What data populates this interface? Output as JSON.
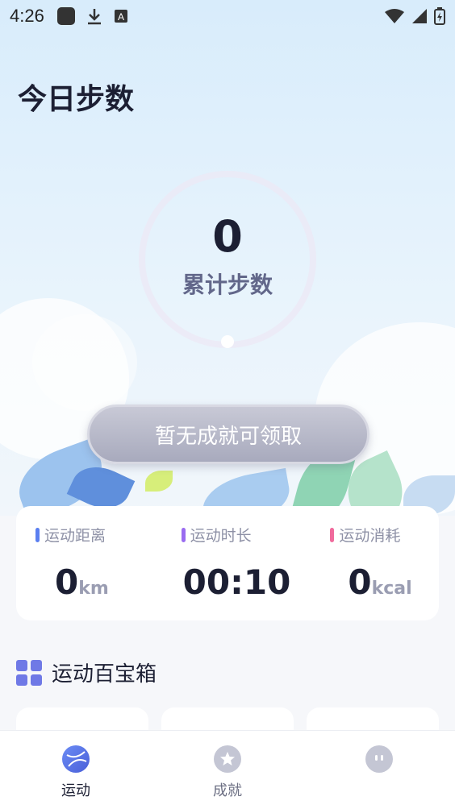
{
  "status_bar": {
    "time": "4:26"
  },
  "header": {
    "title": "今日步数"
  },
  "steps": {
    "count": "0",
    "label": "累计步数"
  },
  "claim_button": {
    "label": "暂无成就可领取"
  },
  "stats": [
    {
      "label": "运动距离",
      "value": "0",
      "unit": "km",
      "color": "#5b7ff0"
    },
    {
      "label": "运动时长",
      "value": "00:10",
      "unit": "",
      "color": "#9a6cf0"
    },
    {
      "label": "运动消耗",
      "value": "0",
      "unit": "kcal",
      "color": "#f06a9c"
    }
  ],
  "toolbox": {
    "title": "运动百宝箱"
  },
  "bottom_nav": [
    {
      "label": "运动",
      "icon": "sport-ball-icon",
      "active": true
    },
    {
      "label": "成就",
      "icon": "star-icon",
      "active": false
    },
    {
      "label": "",
      "icon": "smiley-face-icon",
      "active": false
    }
  ],
  "colors": {
    "accent": "#6f79e6",
    "button": "#b3b5c6"
  }
}
